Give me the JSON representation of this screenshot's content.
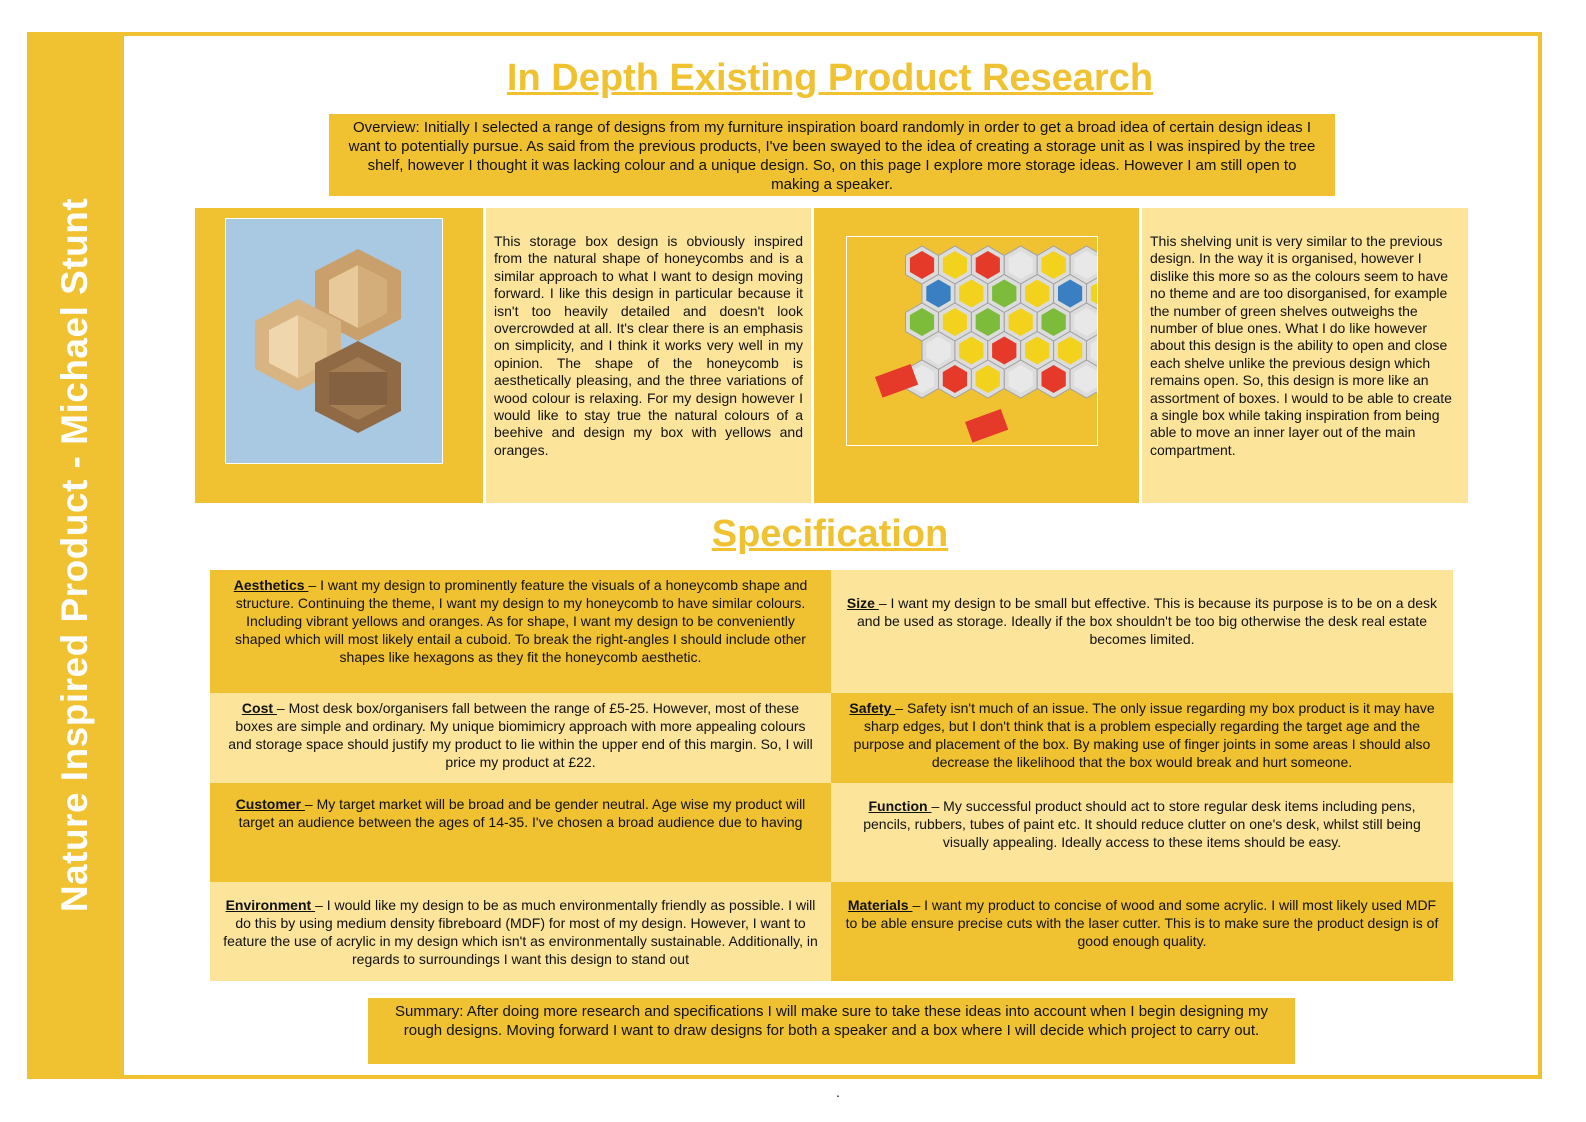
{
  "sidebar": {
    "title": "Nature Inspired Product - Michael Stunt"
  },
  "header": {
    "title": "In Depth Existing Product Research",
    "overview": "Overview: Initially I selected a range of designs from my furniture inspiration board randomly in order to get a broad idea of certain design ideas I want to potentially pursue. As said from the previous products, I've been swayed to the idea of creating a storage unit as I was inspired by the tree shelf, however I thought it was lacking colour and a unique design. So, on this page I explore more storage ideas. However I am still open to making a speaker."
  },
  "research": {
    "product1": {
      "image": "wooden-hexagon-shelves",
      "text": "This storage box design is obviously inspired from the natural shape of honeycombs and is a similar approach to what I want to design moving forward. I like this design in particular because it isn't too heavily detailed and doesn't look overcrowded at all. It's clear there is an emphasis on simplicity, and I think it works very well in my opinion. The shape of the honeycomb is aesthetically pleasing, and the three variations of wood colour is relaxing. For my design however I would like to stay true the natural colours of a beehive and design my box with yellows and oranges."
    },
    "product2": {
      "image": "colourful-hexagon-shelving-unit",
      "text": "This shelving unit is very similar to the previous design. In the way it is organised, however I dislike this more so as the colours seem to have no theme and are too disorganised, for example the number of green shelves outweighs the number of blue ones. What I do like however about this design is the ability to open and close each shelve unlike the previous design which remains open. So, this design is more like an assortment of boxes. I would to be able to create a single box while taking inspiration from being able to move an inner layer out of the main compartment."
    }
  },
  "specification": {
    "title": "Specification",
    "items": [
      {
        "label": "Aesthetics ",
        "text": "– I want my design to prominently feature the visuals of a honeycomb shape and structure. Continuing the theme, I want my design to my honeycomb to have similar colours. Including vibrant yellows and oranges. As for shape, I want my design to be conveniently shaped which will most likely entail a cuboid. To break the right-angles I should include other shapes like hexagons as they fit the honeycomb aesthetic."
      },
      {
        "label": "Size ",
        "text": "– I want my design to be small but effective. This is because its purpose is to be on a desk and be used as storage. Ideally if the box shouldn't be too big otherwise the desk real estate becomes limited."
      },
      {
        "label": "Cost ",
        "text": "– Most desk box/organisers fall between the range of £5-25. However, most of these boxes are simple and ordinary. My unique biomimicry approach with more appealing colours and storage space should justify my product to lie within the upper end of this margin. So, I will price my product at £22."
      },
      {
        "label": "Safety ",
        "text": "–  Safety isn't much of an issue. The only issue regarding my box product is it may have sharp edges, but I don't think that is a problem especially regarding the target age and the purpose and placement of the box. By making use of finger joints in some areas I should also decrease the likelihood that the box would break and hurt someone."
      },
      {
        "label": "Customer ",
        "text": "– My target market will be broad and be gender neutral. Age wise my product will target an audience between the ages of 14-35. I've chosen a broad audience due to having"
      },
      {
        "label": "Function ",
        "text": "– My successful product should act to store regular desk items including pens, pencils, rubbers, tubes of paint etc. It should reduce clutter on one's desk, whilst still being visually appealing. Ideally access to these items should be easy."
      },
      {
        "label": "Environment ",
        "text": "– I would like my design to be as much environmentally friendly as possible. I will do this by using medium density fibreboard (MDF) for most of my design. However, I want to feature the use of acrylic in my design which isn't as environmentally sustainable. Additionally, in regards to surroundings I want this design to stand out"
      },
      {
        "label": "Materials ",
        "text": "– I want my product to concise of wood and some acrylic. I will most likely used MDF to be able ensure precise cuts with the laser cutter. This is to make sure the product design is of good enough quality."
      }
    ]
  },
  "summary": {
    "text": "Summary: After doing more research and specifications I will make sure to take these ideas into account when I begin designing my rough designs. Moving forward I want to draw designs for both a speaker and a box where I will decide which project to carry out."
  },
  "footer": {
    "mark": "."
  },
  "colors": {
    "accent": "#f0c232",
    "light": "#fce49b"
  }
}
